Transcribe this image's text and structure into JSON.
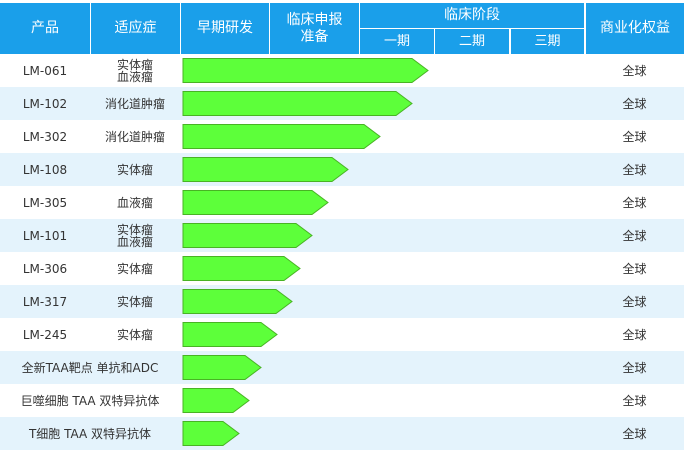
{
  "header": {
    "product": "产品",
    "indication": "适应症",
    "early_research": "早期研发",
    "ind_prep": "临床申报\n准备",
    "clinical_stage": "临床阶段",
    "phase1": "一期",
    "phase2": "二期",
    "phase3": "三期",
    "commercial_rights": "商业化权益"
  },
  "colors": {
    "header_bg": "#1a9fea",
    "alt_row_bg": "#e4f3fc",
    "bar_fill": "#5dff3a",
    "bar_stroke": "#48b324"
  },
  "rows": [
    {
      "product": "LM-061",
      "indication": "实体瘤\n血液瘤",
      "rights": "全球",
      "progress": 0.61
    },
    {
      "product": "LM-102",
      "indication": "消化道肿瘤",
      "rights": "全球",
      "progress": 0.57
    },
    {
      "product": "LM-302",
      "indication": "消化道肿瘤",
      "rights": "全球",
      "progress": 0.49
    },
    {
      "product": "LM-108",
      "indication": "实体瘤",
      "rights": "全球",
      "progress": 0.41
    },
    {
      "product": "LM-305",
      "indication": "血液瘤",
      "rights": "全球",
      "progress": 0.36
    },
    {
      "product": "LM-101",
      "indication": "实体瘤\n血液瘤",
      "rights": "全球",
      "progress": 0.32
    },
    {
      "product": "LM-306",
      "indication": "实体瘤",
      "rights": "全球",
      "progress": 0.29
    },
    {
      "product": "LM-317",
      "indication": "实体瘤",
      "rights": "全球",
      "progress": 0.27
    },
    {
      "product": "LM-245",
      "indication": "实体瘤",
      "rights": "全球",
      "progress": 0.235
    },
    {
      "product": "全新TAA靶点 单抗和ADC",
      "indication": "",
      "rights": "全球",
      "progress": 0.195
    },
    {
      "product": "巨噬细胞 TAA 双特异抗体",
      "indication": "",
      "rights": "全球",
      "progress": 0.165
    },
    {
      "product": "T细胞 TAA 双特异抗体",
      "indication": "",
      "rights": "全球",
      "progress": 0.14
    }
  ]
}
